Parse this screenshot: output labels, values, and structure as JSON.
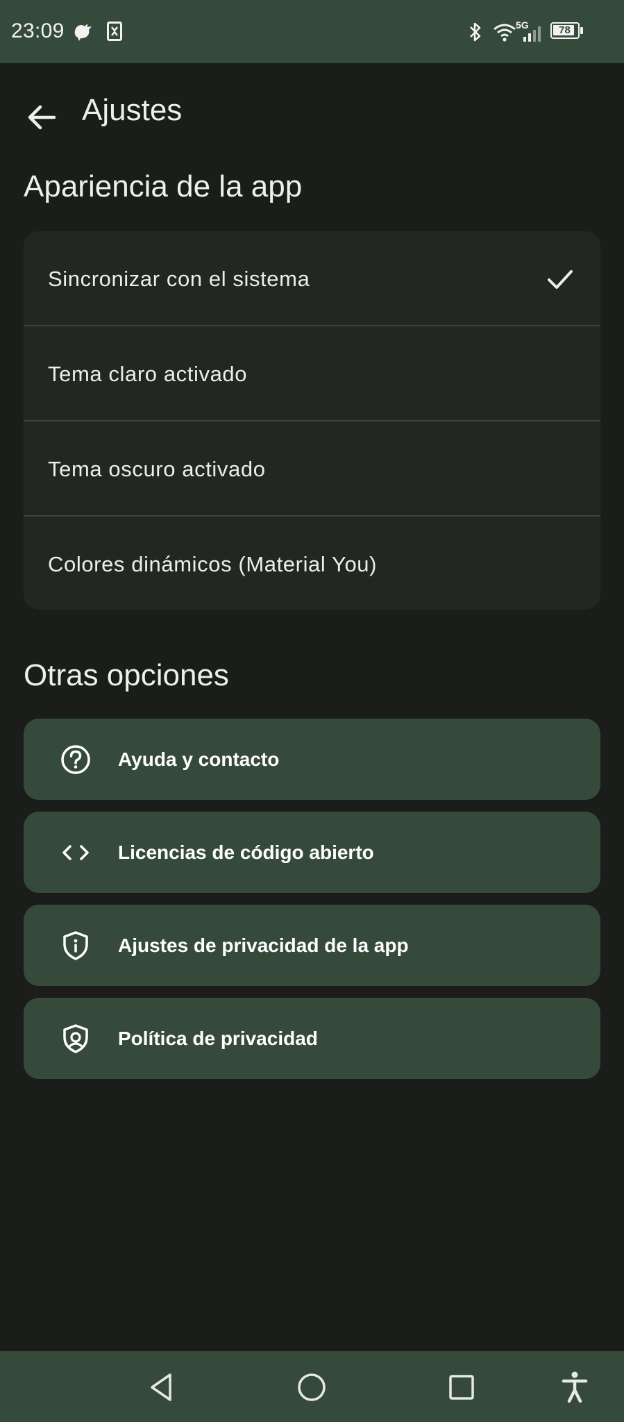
{
  "status_bar": {
    "time": "23:09",
    "network": "5G",
    "battery": "78",
    "icons": [
      "bird-notification-icon",
      "app-notification-icon",
      "bluetooth-icon",
      "wifi-icon",
      "signal-icon",
      "battery-icon"
    ]
  },
  "app_bar": {
    "title": "Ajustes",
    "back_icon": "arrow-back-icon"
  },
  "appearance": {
    "section_title": "Apariencia de la app",
    "options": [
      {
        "label": "Sincronizar con el sistema",
        "selected": true
      },
      {
        "label": "Tema claro activado",
        "selected": false
      },
      {
        "label": "Tema oscuro activado",
        "selected": false
      },
      {
        "label": "Colores dinámicos (Material You)",
        "selected": false
      }
    ]
  },
  "other": {
    "section_title": "Otras opciones",
    "options": [
      {
        "label": "Ayuda y contacto",
        "icon": "help-circle-icon"
      },
      {
        "label": "Licencias de código abierto",
        "icon": "code-icon"
      },
      {
        "label": "Ajustes de privacidad de la app",
        "icon": "shield-info-icon"
      },
      {
        "label": "Política de privacidad",
        "icon": "shield-account-icon"
      }
    ]
  },
  "nav_bar": {
    "buttons": [
      "back-triangle-icon",
      "home-circle-icon",
      "recents-square-icon",
      "accessibility-icon"
    ]
  },
  "colors": {
    "background": "#1b1d1b",
    "status_bar": "#364a3b",
    "card": "#232723",
    "option_button": "#364a3b",
    "text": "#eceeea"
  }
}
